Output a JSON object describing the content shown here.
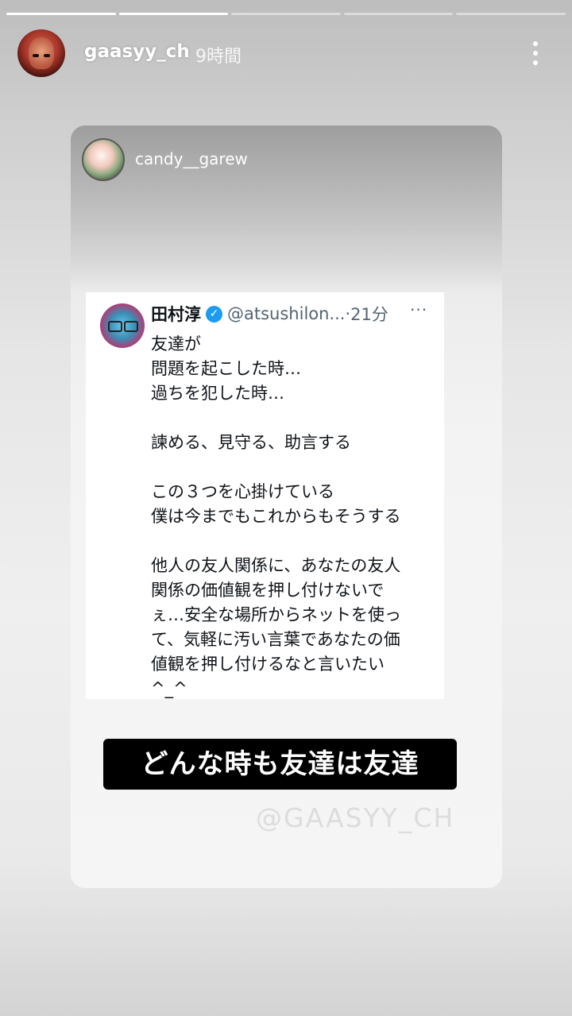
{
  "story": {
    "segments": [
      {
        "progress": 1.0
      },
      {
        "progress": 1.0
      },
      {
        "progress": 0.0
      },
      {
        "progress": 0.0
      },
      {
        "progress": 0.0
      }
    ]
  },
  "header": {
    "username": "gaasyy_ch",
    "time": "9時間",
    "more_icon": "more-vertical-icon"
  },
  "shared_post": {
    "username": "candy__garew"
  },
  "tweet": {
    "name": "田村淳",
    "verified_icon": "verified-check-icon",
    "handle": "@atsushilon...",
    "separator": "·",
    "time": "21分",
    "more": "···",
    "body": "友達が\n問題を起こした時…\n過ちを犯した時…\n\n諫める、見守る、助言する\n\nこの３つを心掛けている\n僕は今までもこれからもそうする\n\n他人の友人関係に、あなたの友人\n関係の価値観を押し付けないで\nぇ…安全な場所からネットを使っ\nて、気軽に汚い言葉であなたの価\n値観を押し付けるなと言いたい\n^_^"
  },
  "caption": "どんな時も友達は友達",
  "watermark": "@GAASYY_CH",
  "colors": {
    "verified": "#1d9bf0",
    "caption_bg": "#000000",
    "caption_text": "#ffffff"
  }
}
